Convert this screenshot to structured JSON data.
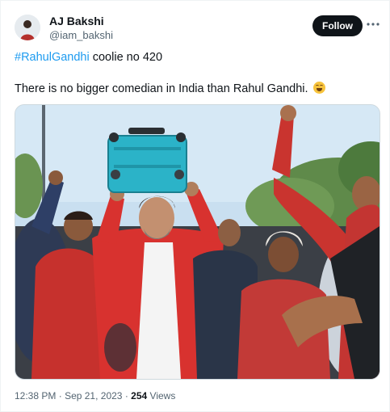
{
  "author": {
    "name": "AJ Bakshi",
    "handle": "@iam_bakshi"
  },
  "follow_label": "Follow",
  "more_icon": "more-options-icon",
  "tweet": {
    "hashtag": "#RahulGandhi",
    "line1_rest": " coolie no 420",
    "line2": "There is no bigger comedian in India than Rahul Gandhi.",
    "emoji": "rolling-on-floor-laughing-emoji"
  },
  "meta": {
    "time": "12:38 PM",
    "separator": "·",
    "date": "Sep 21, 2023",
    "views_count": "254",
    "views_label": "Views"
  },
  "colors": {
    "link": "#1d9bf0",
    "follow_bg": "#0f1419",
    "secondary_text": "#536471",
    "suitcase": "#2bb3c8",
    "shirt_red": "#d8322f"
  }
}
